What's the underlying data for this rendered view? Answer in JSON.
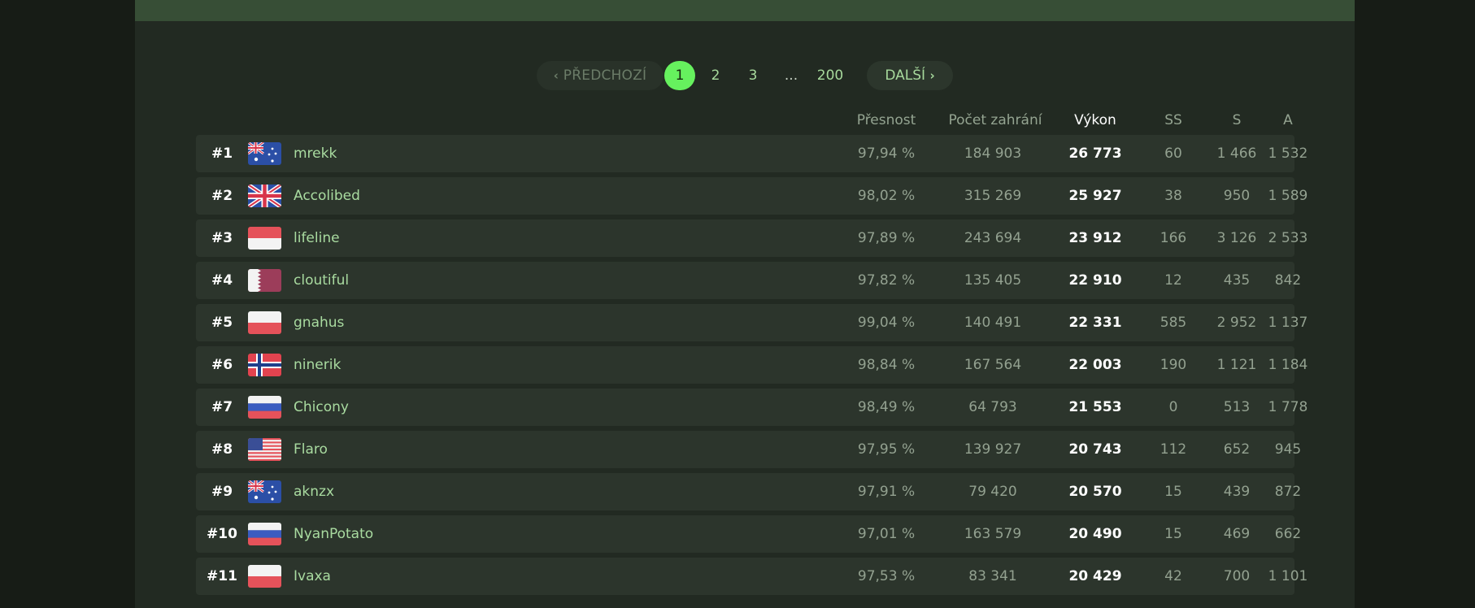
{
  "pagination": {
    "prev_label": "PŘEDCHOZÍ",
    "next_label": "DALŠÍ",
    "pages": [
      "1",
      "2",
      "3",
      "...",
      "200"
    ],
    "current": "1"
  },
  "table": {
    "headers": {
      "accuracy": "Přesnost",
      "play_count": "Počet zahrání",
      "performance": "Výkon",
      "ss": "SS",
      "s": "S",
      "a": "A"
    },
    "rows": [
      {
        "rank": "#1",
        "flag": "AU",
        "name": "mrekk",
        "accuracy": "97,94 %",
        "plays": "184 903",
        "performance": "26 773",
        "ss": "60",
        "s": "1 466",
        "a": "1 532"
      },
      {
        "rank": "#2",
        "flag": "GB",
        "name": "Accolibed",
        "accuracy": "98,02 %",
        "plays": "315 269",
        "performance": "25 927",
        "ss": "38",
        "s": "950",
        "a": "1 589"
      },
      {
        "rank": "#3",
        "flag": "ID",
        "name": "lifeline",
        "accuracy": "97,89 %",
        "plays": "243 694",
        "performance": "23 912",
        "ss": "166",
        "s": "3 126",
        "a": "2 533"
      },
      {
        "rank": "#4",
        "flag": "QA",
        "name": "cloutiful",
        "accuracy": "97,82 %",
        "plays": "135 405",
        "performance": "22 910",
        "ss": "12",
        "s": "435",
        "a": "842"
      },
      {
        "rank": "#5",
        "flag": "PL",
        "name": "gnahus",
        "accuracy": "99,04 %",
        "plays": "140 491",
        "performance": "22 331",
        "ss": "585",
        "s": "2 952",
        "a": "1 137"
      },
      {
        "rank": "#6",
        "flag": "NO",
        "name": "ninerik",
        "accuracy": "98,84 %",
        "plays": "167 564",
        "performance": "22 003",
        "ss": "190",
        "s": "1 121",
        "a": "1 184"
      },
      {
        "rank": "#7",
        "flag": "RU",
        "name": "Chicony",
        "accuracy": "98,49 %",
        "plays": "64 793",
        "performance": "21 553",
        "ss": "0",
        "s": "513",
        "a": "1 778"
      },
      {
        "rank": "#8",
        "flag": "US",
        "name": "Flaro",
        "accuracy": "97,95 %",
        "plays": "139 927",
        "performance": "20 743",
        "ss": "112",
        "s": "652",
        "a": "945"
      },
      {
        "rank": "#9",
        "flag": "AU",
        "name": "aknzx",
        "accuracy": "97,91 %",
        "plays": "79 420",
        "performance": "20 570",
        "ss": "15",
        "s": "439",
        "a": "872"
      },
      {
        "rank": "#10",
        "flag": "RU",
        "name": "NyanPotato",
        "accuracy": "97,01 %",
        "plays": "163 579",
        "performance": "20 490",
        "ss": "15",
        "s": "469",
        "a": "662"
      },
      {
        "rank": "#11",
        "flag": "PL",
        "name": "Ivaxa",
        "accuracy": "97,53 %",
        "plays": "83 341",
        "performance": "20 429",
        "ss": "42",
        "s": "700",
        "a": "1 101"
      }
    ]
  }
}
